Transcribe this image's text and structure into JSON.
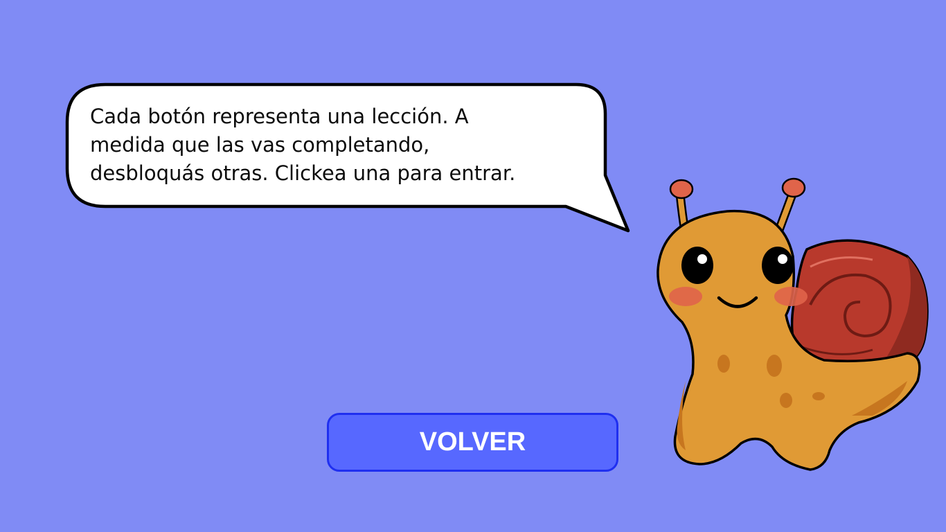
{
  "dialog": {
    "text": "Cada botón representa una lección. A\nmedida que las vas completando,\ndesbloquás otras. Clickea una para entrar."
  },
  "back_button": {
    "label": "VOLVER"
  },
  "mascot": {
    "icon": "snail-mascot-icon"
  },
  "colors": {
    "background": "#808bf5",
    "button": "#5768ff",
    "button_border": "#1f2ff0",
    "snail_body": "#e09a35",
    "snail_shell": "#b8392c"
  }
}
